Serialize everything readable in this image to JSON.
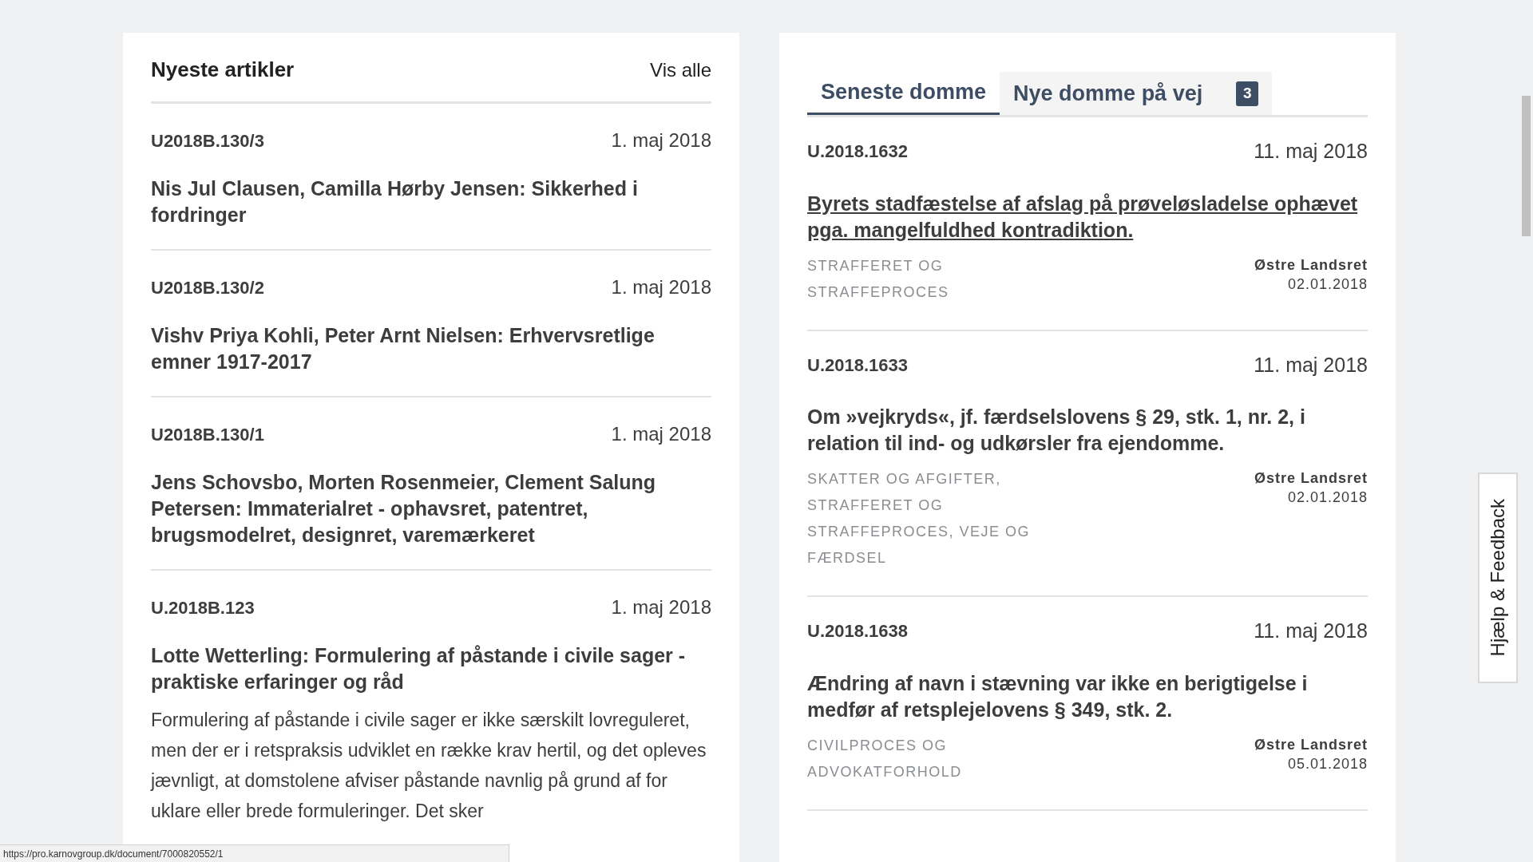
{
  "articles": {
    "title": "Nyeste artikler",
    "view_all": "Vis alle",
    "items": [
      {
        "id": "U2018B.130/3",
        "date": "1. maj 2018",
        "title": "Nis Jul Clausen, Camilla Hørby Jensen: Sikkerhed i fordringer"
      },
      {
        "id": "U2018B.130/2",
        "date": "1. maj 2018",
        "title": "Vishv Priya Kohli, Peter Arnt Nielsen: Erhvervsretlige emner 1917-2017"
      },
      {
        "id": "U2018B.130/1",
        "date": "1. maj 2018",
        "title": "Jens Schovsbo, Morten Rosenmeier, Clement Salung Petersen: Immaterialret - ophavsret, patentret, brugsmodelret, designret, varemærkeret"
      },
      {
        "id": "U.2018B.123",
        "date": "1. maj 2018",
        "title": "Lotte Wetterling: Formulering af påstande i civile sager - praktiske erfaringer og råd",
        "summary": "Formulering af påstande i civile sager er ikke særskilt lovreguleret, men der er i retspraksis udviklet en række krav hertil, og det opleves jævnligt, at domstolene afviser påstande navnlig på grund af for uklare eller brede formuleringer. Det sker"
      }
    ]
  },
  "judgments": {
    "tabs": [
      {
        "label": "Seneste domme",
        "selected": true
      },
      {
        "label": "Nye domme på vej",
        "selected": false,
        "badge": "3"
      }
    ],
    "items": [
      {
        "id": "U.2018.1632",
        "date": "11. maj 2018",
        "title": "Byrets stadfæstelse af afslag på prøveløsladelse ophævet pga. mangelfuldhed kontradiktion.",
        "hovered": true,
        "categories": "STRAFFERET OG STRAFFEPROCES",
        "court": "Østre Landsret",
        "decision_date": "02.01.2018"
      },
      {
        "id": "U.2018.1633",
        "date": "11. maj 2018",
        "title": "Om »vejkryds«, jf. færdselslovens § 29, stk. 1, nr. 2, i relation til ind- og udkørsler fra ejendomme.",
        "hovered": false,
        "categories": "SKATTER OG AFGIFTER, STRAFFERET OG STRAFFEPROCES, VEJE OG FÆRDSEL",
        "court": "Østre Landsret",
        "decision_date": "02.01.2018"
      },
      {
        "id": "U.2018.1638",
        "date": "11. maj 2018",
        "title": "Ændring af navn i stævning var ikke en berigtigelse i medfør af retsplejelovens § 349, stk. 2.",
        "hovered": false,
        "categories": "CIVILPROCES OG ADVOKATFORHOLD",
        "court": "Østre Landsret",
        "decision_date": "05.01.2018"
      }
    ]
  },
  "feedback_tab": "Hjælp & Feedback",
  "status_bar": "https://pro.karnovgroup.dk/document/7000820552/1"
}
